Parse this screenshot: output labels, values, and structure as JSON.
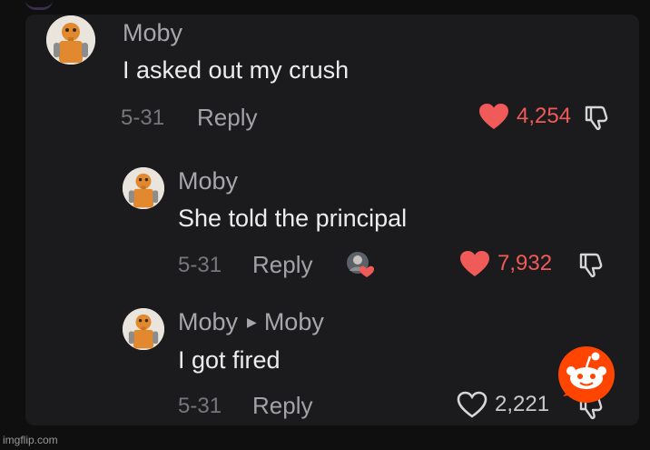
{
  "comments": [
    {
      "author": "Moby",
      "text": "I asked out my crush",
      "date": "5-31",
      "reply_label": "Reply",
      "likes": "4,254",
      "liked": true
    },
    {
      "author": "Moby",
      "text": "She told the principal",
      "date": "5-31",
      "reply_label": "Reply",
      "likes": "7,932",
      "liked": true,
      "creator_liked": true
    },
    {
      "author": "Moby",
      "reply_to": "Moby",
      "text": "I got fired",
      "date": "5-31",
      "reply_label": "Reply",
      "likes": "2,221",
      "liked": false
    }
  ],
  "watermark": "imgflip.com",
  "colors": {
    "background": "#0f0f10",
    "panel": "#1b1b1d",
    "like_red": "#f05a58",
    "avatar_orange": "#e2892f",
    "reddit_orange": "#ff4500"
  },
  "icons": {
    "like": "heart-icon",
    "dislike": "thumbs-down-icon",
    "creator_badge": "creator-liked-badge-icon",
    "overlay_logo": "reddit-snoo-icon"
  }
}
